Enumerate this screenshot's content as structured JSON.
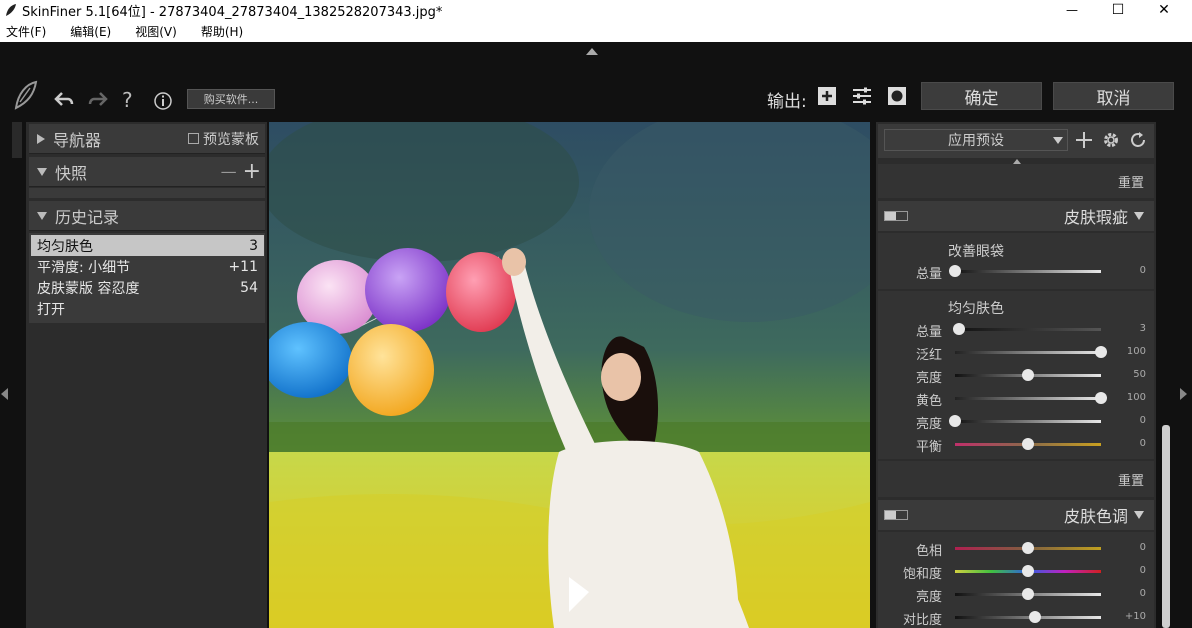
{
  "window": {
    "title": "SkinFiner 5.1[64位] - 27873404_27873404_1382528207343.jpg*",
    "minimize": "—",
    "maximize": "☐",
    "close": "✕"
  },
  "menu": [
    "文件(F)",
    "编辑(E)",
    "视图(V)",
    "帮助(H)"
  ],
  "toolbar": {
    "buy_label": "购买软件...",
    "help_glyph": "?",
    "output_label": "输出:",
    "ok_label": "确定",
    "cancel_label": "取消"
  },
  "left_panel": {
    "navigator": {
      "title": "导航器",
      "preview_mask": "预览蒙板"
    },
    "snapshot": {
      "title": "快照",
      "minus": "—",
      "plus": "+"
    },
    "history": {
      "title": "历史记录",
      "items": [
        {
          "label": "均匀肤色",
          "value": "3",
          "selected": true
        },
        {
          "label": "平滑度: 小细节",
          "value": "+11",
          "selected": false
        },
        {
          "label": "皮肤蒙版 容忍度",
          "value": "54",
          "selected": false
        },
        {
          "label": "打开",
          "value": "",
          "selected": false
        }
      ]
    }
  },
  "right_panel": {
    "preset_label": "应用预设",
    "reset_label": "重置",
    "blemish": {
      "title": "皮肤瑕疵",
      "eye_bags": {
        "title": "改善眼袋",
        "sliders": [
          {
            "label": "总量",
            "value": "0",
            "pos": 0
          }
        ]
      },
      "even_tone": {
        "title": "均匀肤色",
        "sliders": [
          {
            "label": "总量",
            "value": "3",
            "pos": 0.03,
            "track": "dark"
          },
          {
            "label": "泛红",
            "value": "100",
            "pos": 1.0,
            "track": "red"
          },
          {
            "label": "亮度",
            "value": "50",
            "pos": 0.5,
            "track": "gray"
          },
          {
            "label": "黄色",
            "value": "100",
            "pos": 1.0,
            "track": "yellow"
          },
          {
            "label": "亮度",
            "value": "0",
            "pos": 0,
            "track": "gray"
          },
          {
            "label": "平衡",
            "value": "0",
            "pos": 0.5,
            "track": "balance"
          }
        ]
      }
    },
    "skin_tone": {
      "title": "皮肤色调",
      "sliders": [
        {
          "label": "色相",
          "value": "0",
          "pos": 0.5,
          "track": "hue"
        },
        {
          "label": "饱和度",
          "value": "0",
          "pos": 0.5,
          "track": "sat"
        },
        {
          "label": "亮度",
          "value": "0",
          "pos": 0.5,
          "track": "gray"
        },
        {
          "label": "对比度",
          "value": "+10",
          "pos": 0.55,
          "track": "gray"
        }
      ]
    }
  }
}
